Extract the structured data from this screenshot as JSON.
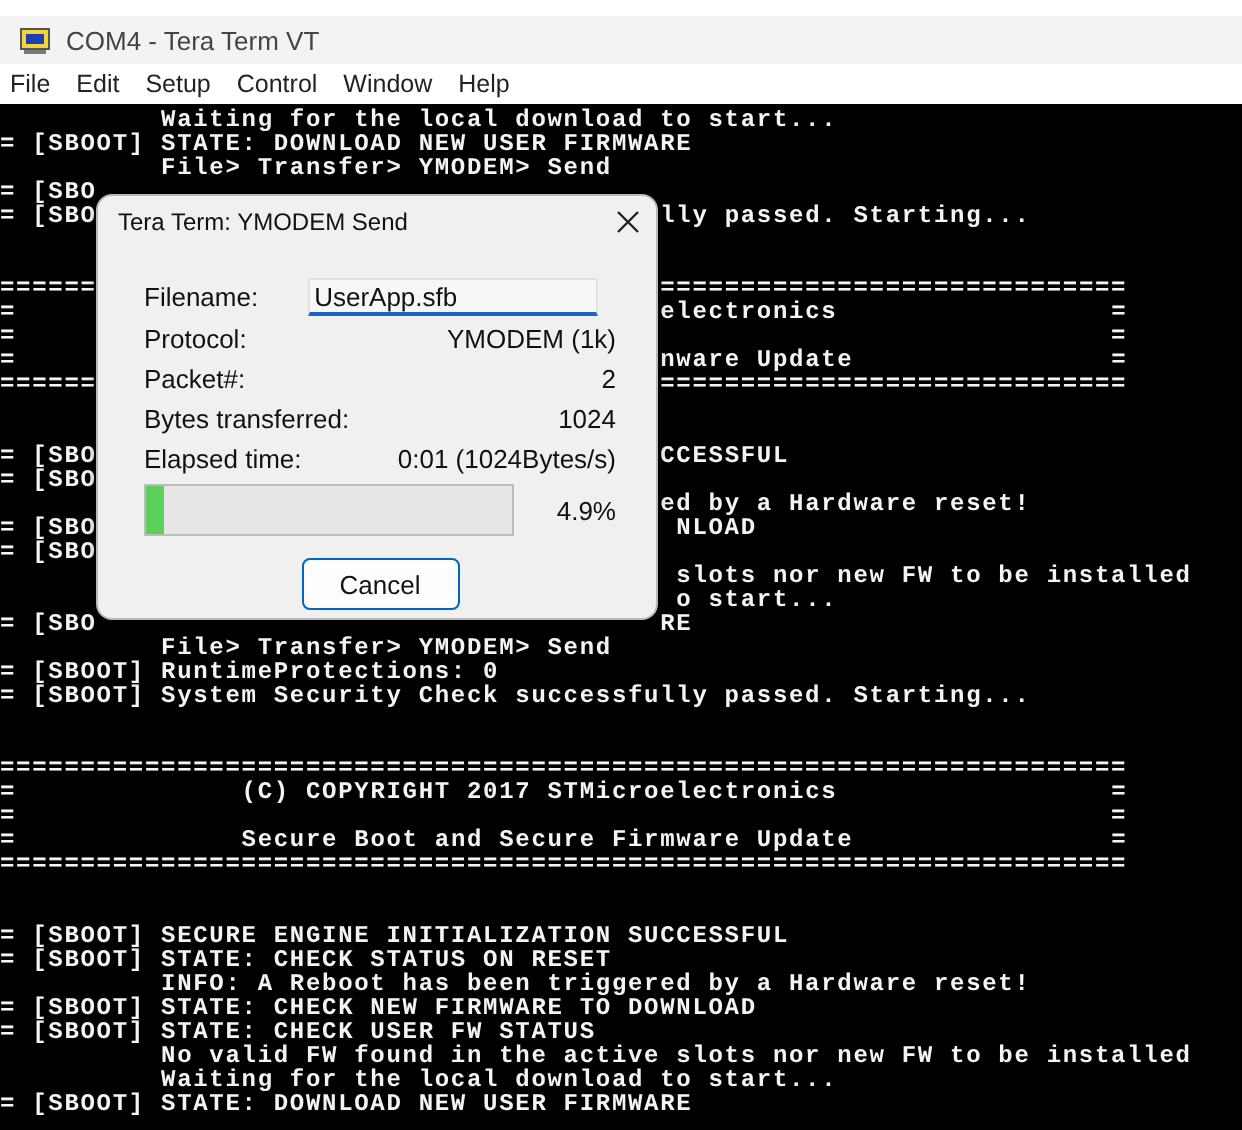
{
  "window": {
    "title": "COM4 - Tera Term VT"
  },
  "menu": [
    "File",
    "Edit",
    "Setup",
    "Control",
    "Window",
    "Help"
  ],
  "terminal": {
    "blocks": [
      [
        "          Waiting for the local download to start...",
        "= [SBOOT] STATE: DOWNLOAD NEW USER FIRMWARE",
        "          File> Transfer> YMODEM> Send",
        "= [SBO",
        "= [SBO                                   lly passed. Starting..."
      ],
      [
        "======                                   =============================",
        "=                                        electronics                 =",
        "=                                                                    =",
        "=                                        nware Update                =",
        "======                                   ============================="
      ],
      [
        "= [SBO                                   CCESSFUL",
        "= [SBO",
        "                                         ed by a Hardware reset!",
        "= [SBO                                    NLOAD",
        "= [SBO",
        "                                          slots nor new FW to be installed",
        "                                          o start...",
        "= [SBO                                   RE",
        "          File> Transfer> YMODEM> Send",
        "= [SBOOT] RuntimeProtections: 0",
        "= [SBOOT] System Security Check successfully passed. Starting..."
      ],
      [
        "======================================================================",
        "=              (C) COPYRIGHT 2017 STMicroelectronics                 =",
        "=                                                                    =",
        "=              Secure Boot and Secure Firmware Update                =",
        "======================================================================"
      ],
      [
        "= [SBOOT] SECURE ENGINE INITIALIZATION SUCCESSFUL",
        "= [SBOOT] STATE: CHECK STATUS ON RESET",
        "          INFO: A Reboot has been triggered by a Hardware reset!",
        "= [SBOOT] STATE: CHECK NEW FIRMWARE TO DOWNLOAD",
        "= [SBOOT] STATE: CHECK USER FW STATUS",
        "          No valid FW found in the active slots nor new FW to be installed",
        "          Waiting for the local download to start...",
        "= [SBOOT] STATE: DOWNLOAD NEW USER FIRMWARE"
      ]
    ]
  },
  "dialog": {
    "title": "Tera Term: YMODEM Send",
    "fields": [
      {
        "kind": "input",
        "label": "Filename:",
        "value": "UserApp.sfb"
      },
      {
        "kind": "text",
        "label": "Protocol:",
        "value": "YMODEM (1k)"
      },
      {
        "kind": "text",
        "label": "Packet#:",
        "value": "2"
      },
      {
        "kind": "text",
        "label": "Bytes transferred:",
        "value": "1024"
      },
      {
        "kind": "text",
        "label": "Elapsed time:",
        "value": "0:01 (1024Bytes/s)"
      }
    ],
    "progress": {
      "level": 0.049,
      "reading": "4.9%"
    },
    "buttons": [
      "Cancel"
    ]
  }
}
